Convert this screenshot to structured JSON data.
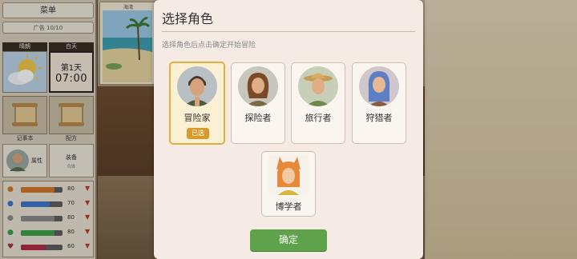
{
  "sidebar": {
    "menu_label": "菜单",
    "ads_label": "广告 10/10",
    "weather_label": "晴朗",
    "time_of_day_label": "白天",
    "day_label": "第1天",
    "clock": "07:00",
    "notes_label": "记事本",
    "recipe_label": "配方",
    "attributes_label": "属性",
    "equipment_label": "装备",
    "equipment_count": "0/8",
    "stats": [
      {
        "icon": "drumstick-icon",
        "value": "80",
        "color": "#d2772a",
        "level": 0.8
      },
      {
        "icon": "water-drop-icon",
        "value": "70",
        "color": "#3d78c8",
        "level": 0.7
      },
      {
        "icon": "sanity-icon",
        "value": "80",
        "color": "#8a8a8a",
        "level": 0.8
      },
      {
        "icon": "stamina-icon",
        "value": "80",
        "color": "#3ca048",
        "level": 0.8
      },
      {
        "icon": "heart-icon",
        "value": "60",
        "color": "#b02a4a",
        "level": 0.6
      }
    ]
  },
  "beach_card": {
    "label": "海湾"
  },
  "dialog": {
    "title": "选择角色",
    "subtitle": "选择角色后点击确定开始冒险",
    "characters": [
      {
        "name": "冒险家",
        "selected": true,
        "badge": "已选"
      },
      {
        "name": "探险者",
        "selected": false
      },
      {
        "name": "旅行者",
        "selected": false
      },
      {
        "name": "狩猎者",
        "selected": false
      },
      {
        "name": "博学者",
        "selected": false
      }
    ],
    "confirm_label": "确定"
  },
  "colors": {
    "accent_green": "#5ea34a",
    "selected_border": "#e0b040",
    "dialog_bg": "#f6eae4"
  }
}
